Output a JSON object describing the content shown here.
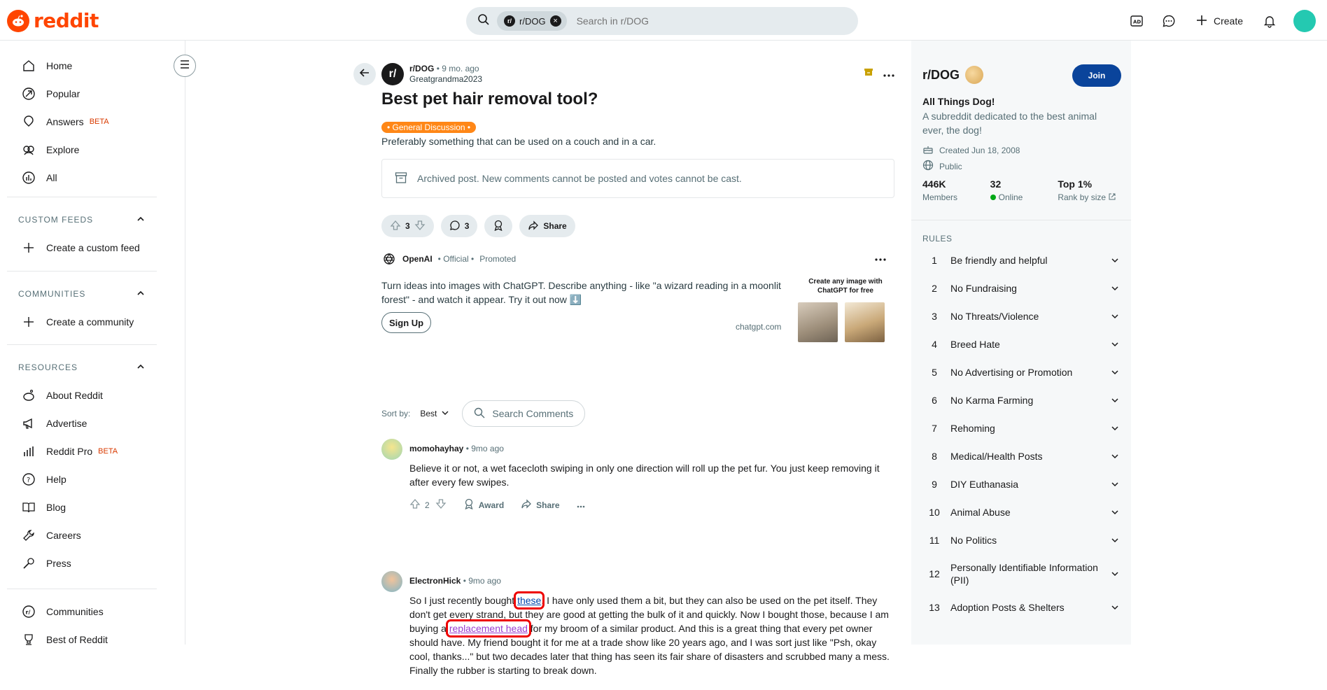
{
  "header": {
    "logo_text": "reddit",
    "search_chip": "r/DOG",
    "search_placeholder": "Search in r/DOG",
    "create_label": "Create"
  },
  "sidebar": {
    "main_items": [
      {
        "label": "Home",
        "icon": "home-icon"
      },
      {
        "label": "Popular",
        "icon": "popular-icon"
      },
      {
        "label": "Answers",
        "icon": "answers-icon",
        "badge": "BETA"
      },
      {
        "label": "Explore",
        "icon": "explore-icon"
      },
      {
        "label": "All",
        "icon": "all-icon"
      }
    ],
    "custom_feeds": {
      "title": "CUSTOM FEEDS",
      "item": "Create a custom feed"
    },
    "communities": {
      "title": "COMMUNITIES",
      "item": "Create a community"
    },
    "resources": {
      "title": "RESOURCES",
      "items": [
        {
          "label": "About Reddit"
        },
        {
          "label": "Advertise"
        },
        {
          "label": "Reddit Pro",
          "badge": "BETA"
        },
        {
          "label": "Help"
        },
        {
          "label": "Blog"
        },
        {
          "label": "Careers"
        },
        {
          "label": "Press"
        }
      ]
    },
    "bottom_items": [
      {
        "label": "Communities"
      },
      {
        "label": "Best of Reddit"
      }
    ]
  },
  "post": {
    "subreddit": "r/DOG",
    "sub_avatar_text": "r/",
    "age": "• 9 mo. ago",
    "author": "Greatgrandma2023",
    "title": "Best pet hair removal tool?",
    "flair": "• General Discussion •",
    "body": "Preferably something that can be used on a couch and in a car.",
    "archived_notice": "Archived post. New comments cannot be posted and votes cannot be cast.",
    "votes": "3",
    "comments_count": "3",
    "share_label": "Share"
  },
  "ad": {
    "advertiser": "OpenAI",
    "official": "• Official •",
    "promoted": "Promoted",
    "text": "Turn ideas into images with ChatGPT. Describe anything - like \"a wizard reading in a moonlit forest\" - and watch it appear. Try it out now ⬇️",
    "cta": "Sign Up",
    "domain": "chatgpt.com",
    "image_title": "Create any image with ChatGPT for free"
  },
  "comments_bar": {
    "sort_label": "Sort by:",
    "sort_value": "Best",
    "search_placeholder": "Search Comments"
  },
  "comments": [
    {
      "author": "momohayhay",
      "time": "• 9mo ago",
      "body": "Believe it or not, a wet facecloth swiping in only one direction will roll up the pet fur. You just keep removing it after every few swipes.",
      "votes": "2",
      "award_label": "Award",
      "share_label": "Share"
    },
    {
      "author": "ElectronHick",
      "time": "• 9mo ago",
      "body_1": "So I just recently bought ",
      "link_1": "these",
      "body_2": ". I have only used them a bit, but they can also be used on the pet itself. They don't get every strand, but they are good at getting the bulk of it and quickly. Now I bought those, because I am buying a ",
      "link_2": "replacement head",
      "body_3": " for my broom of a similar product. And this is a great thing that every pet owner should have. My friend bought it for me at a trade show like 20 years ago, and I was sort just like \"Psh, okay cool, thanks...\" but two decades later that thing has seen its fair share of disasters and scrubbed many a mess. Finally the rubber is starting to break down."
    }
  ],
  "community": {
    "name": "r/DOG",
    "join_label": "Join",
    "title": "All Things Dog!",
    "description": "A subreddit dedicated to the best animal ever, the dog!",
    "created": "Created Jun 18, 2008",
    "visibility": "Public",
    "members_value": "446K",
    "members_label": "Members",
    "online_value": "32",
    "online_label": "Online",
    "rank_value": "Top 1%",
    "rank_label": "Rank by size",
    "rules_title": "RULES",
    "rules": [
      {
        "n": "1",
        "t": "Be friendly and helpful"
      },
      {
        "n": "2",
        "t": "No Fundraising"
      },
      {
        "n": "3",
        "t": "No Threats/Violence"
      },
      {
        "n": "4",
        "t": "Breed Hate"
      },
      {
        "n": "5",
        "t": "No Advertising or Promotion"
      },
      {
        "n": "6",
        "t": "No Karma Farming"
      },
      {
        "n": "7",
        "t": "Rehoming"
      },
      {
        "n": "8",
        "t": "Medical/Health Posts"
      },
      {
        "n": "9",
        "t": "DIY Euthanasia"
      },
      {
        "n": "10",
        "t": "Animal Abuse"
      },
      {
        "n": "11",
        "t": "No Politics"
      },
      {
        "n": "12",
        "t": "Personally Identifiable Information (PII)"
      },
      {
        "n": "13",
        "t": "Adoption Posts & Shelters"
      }
    ]
  },
  "colors": {
    "brand": "#ff4500",
    "join": "#0a449b",
    "flair": "#ff8717",
    "highlight": "#ee0000"
  }
}
